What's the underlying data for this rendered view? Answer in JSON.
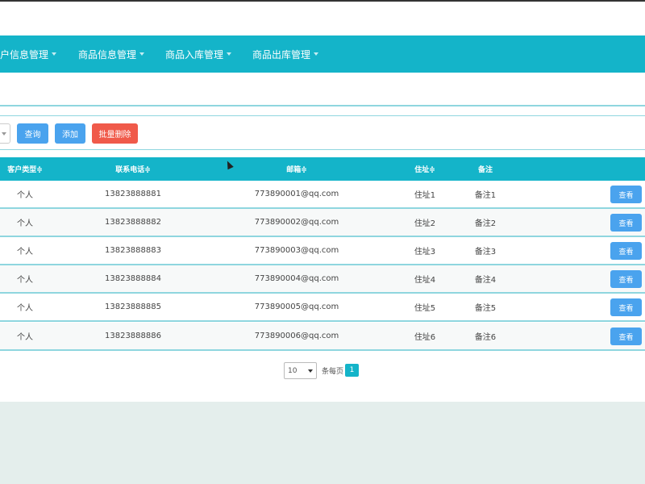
{
  "nav": {
    "items": [
      {
        "label": "户信息管理"
      },
      {
        "label": "商品信息管理"
      },
      {
        "label": "商品入库管理"
      },
      {
        "label": "商品出库管理"
      }
    ]
  },
  "toolbar": {
    "query_label": "查询",
    "add_label": "添加",
    "batch_delete_label": "批量删除"
  },
  "table": {
    "headers": {
      "customer_type": "客户类型≑",
      "phone": "联系电话≑",
      "email": "邮箱≑",
      "address": "住址≑",
      "remark": "备注"
    },
    "rows": [
      {
        "customer_type": "个人",
        "phone": "13823888881",
        "email": "773890001@qq.com",
        "address": "住址1",
        "remark": "备注1",
        "action": "查看"
      },
      {
        "customer_type": "个人",
        "phone": "13823888882",
        "email": "773890002@qq.com",
        "address": "住址2",
        "remark": "备注2",
        "action": "查看"
      },
      {
        "customer_type": "个人",
        "phone": "13823888883",
        "email": "773890003@qq.com",
        "address": "住址3",
        "remark": "备注3",
        "action": "查看"
      },
      {
        "customer_type": "个人",
        "phone": "13823888884",
        "email": "773890004@qq.com",
        "address": "住址4",
        "remark": "备注4",
        "action": "查看"
      },
      {
        "customer_type": "个人",
        "phone": "13823888885",
        "email": "773890005@qq.com",
        "address": "住址5",
        "remark": "备注5",
        "action": "查看"
      },
      {
        "customer_type": "个人",
        "phone": "13823888886",
        "email": "773890006@qq.com",
        "address": "住址6",
        "remark": "备注6",
        "action": "查看"
      }
    ]
  },
  "pagination": {
    "page_size": "10",
    "per_page_label": "条每页",
    "current_page": "1"
  },
  "colors": {
    "nav_bg": "#14b4c9",
    "primary_button": "#4aa3ee",
    "danger_button": "#f05a4a"
  }
}
